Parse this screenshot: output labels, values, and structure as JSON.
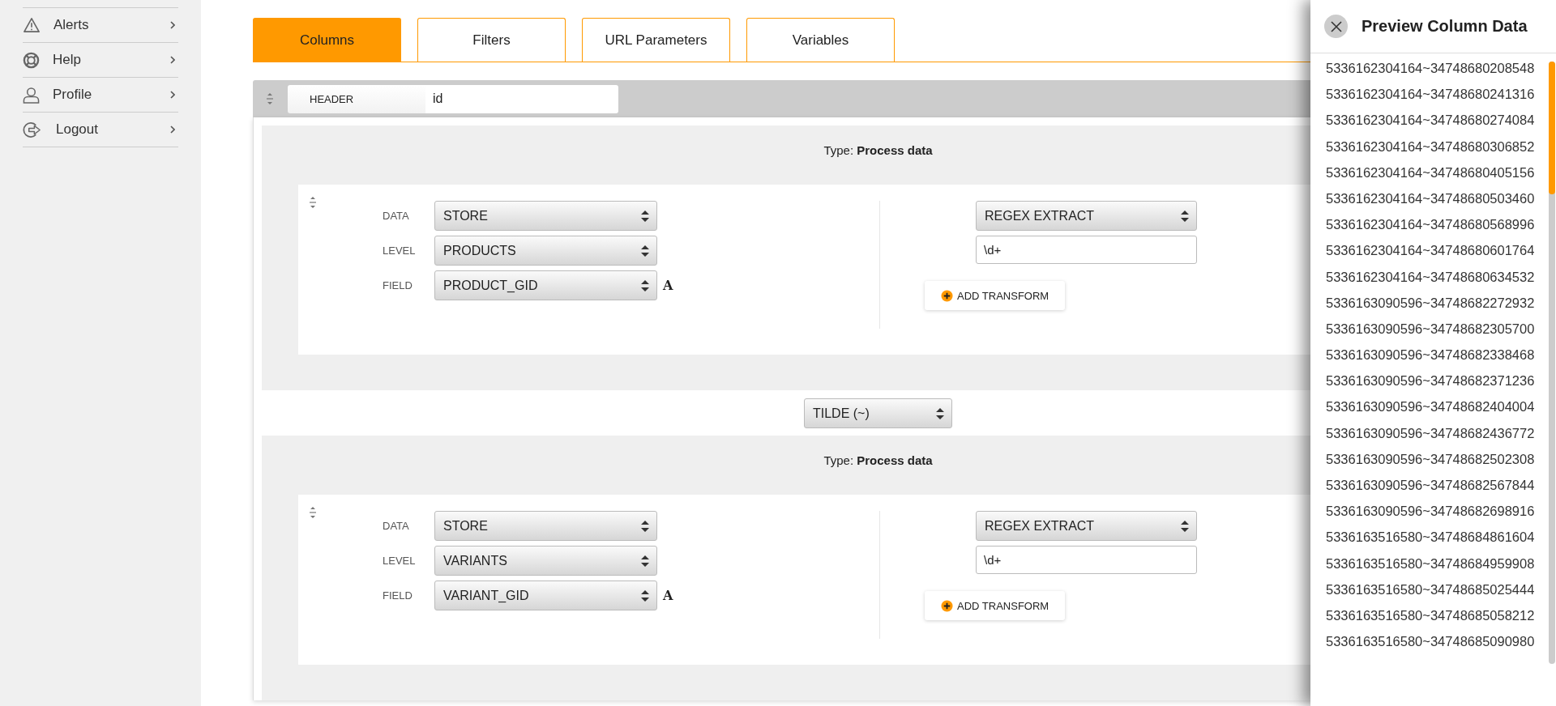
{
  "sidebar": {
    "items": [
      {
        "label": "Alerts"
      },
      {
        "label": "Help"
      },
      {
        "label": "Profile"
      },
      {
        "label": "Logout"
      }
    ]
  },
  "tabs": [
    {
      "label": "Columns",
      "selected": true
    },
    {
      "label": "Filters",
      "selected": false
    },
    {
      "label": "URL Parameters",
      "selected": false
    },
    {
      "label": "Variables",
      "selected": false
    }
  ],
  "header": {
    "label": "HEADER",
    "value": "id"
  },
  "blocks": [
    {
      "type_text": "Type: **Process data**",
      "fields": [
        {
          "label": "DATA",
          "value": "STORE"
        },
        {
          "label": "LEVEL",
          "value": "PRODUCTS"
        },
        {
          "label": "FIELD",
          "value": "PRODUCT_GID",
          "badge": "A"
        }
      ],
      "transform": {
        "select": "REGEX EXTRACT",
        "input": "\\d+"
      },
      "add_button": "ADD TRANSFORM"
    },
    {
      "type_text": "Type: **Process data**",
      "fields": [
        {
          "label": "DATA",
          "value": "STORE"
        },
        {
          "label": "LEVEL",
          "value": "VARIANTS"
        },
        {
          "label": "FIELD",
          "value": "VARIANT_GID",
          "badge": "A"
        }
      ],
      "transform": {
        "select": "REGEX EXTRACT",
        "input": "\\d+"
      },
      "add_button": "ADD TRANSFORM"
    }
  ],
  "separators": [
    "TILDE (~)"
  ],
  "drawer": {
    "title": "Preview Column Data",
    "values": [
      "5336162304164~34748680208548",
      "5336162304164~34748680241316",
      "5336162304164~34748680274084",
      "5336162304164~34748680306852",
      "5336162304164~34748680405156",
      "5336162304164~34748680503460",
      "5336162304164~34748680568996",
      "5336162304164~34748680601764",
      "5336162304164~34748680634532",
      "5336163090596~34748682272932",
      "5336163090596~34748682305700",
      "5336163090596~34748682338468",
      "5336163090596~34748682371236",
      "5336163090596~34748682404004",
      "5336163090596~34748682436772",
      "5336163090596~34748682502308",
      "5336163090596~34748682567844",
      "5336163090596~34748682698916",
      "5336163516580~34748684861604",
      "5336163516580~34748684959908",
      "5336163516580~34748685025444",
      "5336163516580~34748685058212",
      "5336163516580~34748685090980"
    ]
  }
}
